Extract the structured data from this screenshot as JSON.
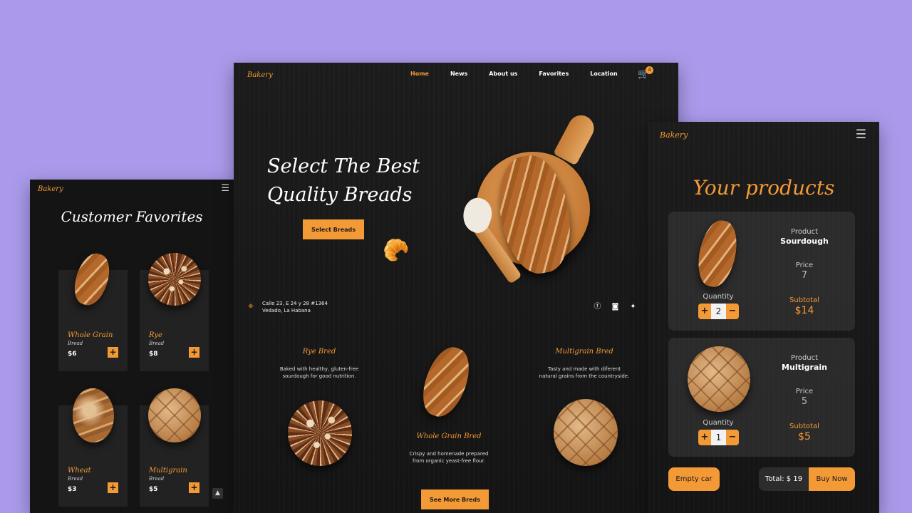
{
  "mobile_favorites": {
    "brand": "Bakery",
    "menu_icon": "hamburger-icon",
    "title": "Customer Favorites",
    "products": [
      {
        "name": "Whole Grain",
        "sub": "Bread",
        "price": "$6",
        "add": "+"
      },
      {
        "name": "Rye",
        "sub": "Bread",
        "price": "$8",
        "add": "+"
      },
      {
        "name": "Wheat",
        "sub": "Bread",
        "price": "$3",
        "add": "+"
      },
      {
        "name": "Multigrain",
        "sub": "Bread",
        "price": "$5",
        "add": "+"
      }
    ],
    "scroll_top_icon": "arrow-up-icon"
  },
  "desktop": {
    "brand": "Bakery",
    "nav": [
      "Home",
      "News",
      "About us",
      "Favorites",
      "Location"
    ],
    "active_nav": "Home",
    "cart_count": "4",
    "hero_title_line1": "Select The Best",
    "hero_title_line2": "Quality Breads",
    "hero_button": "Select Breads",
    "address_line1": "Calle 23, E 24 y 28 #1364",
    "address_line2": "Vedado, La Habana",
    "social_icons": [
      "facebook-icon",
      "instagram-icon",
      "twitter-icon"
    ],
    "features": [
      {
        "title": "Rye Bred",
        "desc_line1": "Baked with healthy, gluten-free",
        "desc_line2": "sourdough for good nutrition."
      },
      {
        "title": "Whole Grain Bred",
        "desc_line1": "Crispy and homenade prepared",
        "desc_line2": "from organic yeast-free flour."
      },
      {
        "title": "Multigrain Bred",
        "desc_line1": "Tasty and made with diferent",
        "desc_line2": "natural grains from the countryside."
      }
    ],
    "see_more": "See More Breds"
  },
  "mobile_cart": {
    "brand": "Bakery",
    "title": "Your products",
    "items": [
      {
        "product_label": "Product",
        "product": "Sourdough",
        "price_label": "Price",
        "price": "7",
        "quantity_label": "Quantity",
        "quantity": "2",
        "subtotal_label": "Subtotal",
        "subtotal": "$14"
      },
      {
        "product_label": "Product",
        "product": "Multigrain",
        "price_label": "Price",
        "price": "5",
        "quantity_label": "Quantity",
        "quantity": "1",
        "subtotal_label": "Subtotal",
        "subtotal": "$5"
      }
    ],
    "empty_cart": "Empty car",
    "total": "Total: $ 19",
    "buy_now": "Buy Now"
  },
  "colors": {
    "accent": "#f39a36",
    "background": "#ab9aeb",
    "panel": "#141414"
  }
}
